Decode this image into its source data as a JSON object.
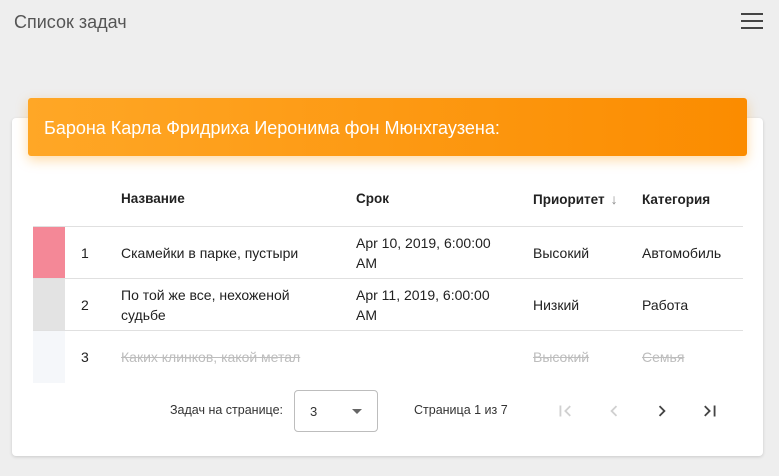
{
  "app": {
    "title": "Список задач"
  },
  "card": {
    "header": "Барона Карла Фридриха Иеронима фон Мюнхгаузена:"
  },
  "table": {
    "headers": {
      "name": "Название",
      "date": "Срок",
      "priority": "Приоритет",
      "category": "Категория"
    },
    "rows": [
      {
        "num": "1",
        "name": "Скамейки в парке, пустыри",
        "date": "Apr 10, 2019, 6:00:00 AM",
        "priority": "Высокий",
        "category": "Автомобиль",
        "color": "#f48897",
        "done": false
      },
      {
        "num": "2",
        "name": "По той же все, нехоженой судьбе",
        "date": "Apr 11, 2019, 6:00:00 AM",
        "priority": "Низкий",
        "category": "Работа",
        "color": "#e3e3e3",
        "done": false
      },
      {
        "num": "3",
        "name": "Каких клинков, какой метал",
        "date": "",
        "priority": "Высокий",
        "category": "Семья",
        "color": "#f5f7fa",
        "done": true
      }
    ]
  },
  "pager": {
    "label": "Задач на странице:",
    "page_size": "3",
    "range": "Страница 1 из 7"
  },
  "icons": {
    "menu": "menu-icon",
    "sort": "arrow-down-icon",
    "first": "first-page-icon",
    "prev": "chevron-left-icon",
    "next": "chevron-right-icon",
    "last": "last-page-icon"
  }
}
